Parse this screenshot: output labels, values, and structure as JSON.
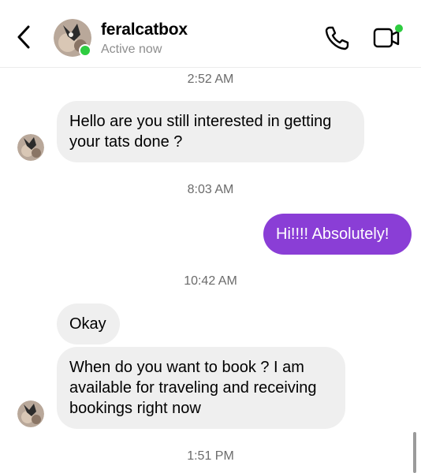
{
  "header": {
    "username": "feralcatbox",
    "status": "Active now",
    "icons": {
      "back": "chevron-left-icon",
      "call": "phone-icon",
      "video": "video-camera-icon"
    },
    "colors": {
      "online_dot": "#2ecc40"
    }
  },
  "messages": {
    "ts1": "2:52 AM",
    "m1": "Hello are you still interested in getting your tats done ?",
    "ts2": "8:03 AM",
    "m2": "Hi!!!! Absolutely!",
    "ts3": "10:42 AM",
    "m3": "Okay",
    "m4": "When do you want to book ? I am available for traveling and receiving bookings right  now",
    "ts4": "1:51 PM"
  },
  "colors": {
    "incoming_bubble": "#efefef",
    "outgoing_bubble": "#8a3ed6",
    "timestamp_text": "#6b6b6b"
  }
}
